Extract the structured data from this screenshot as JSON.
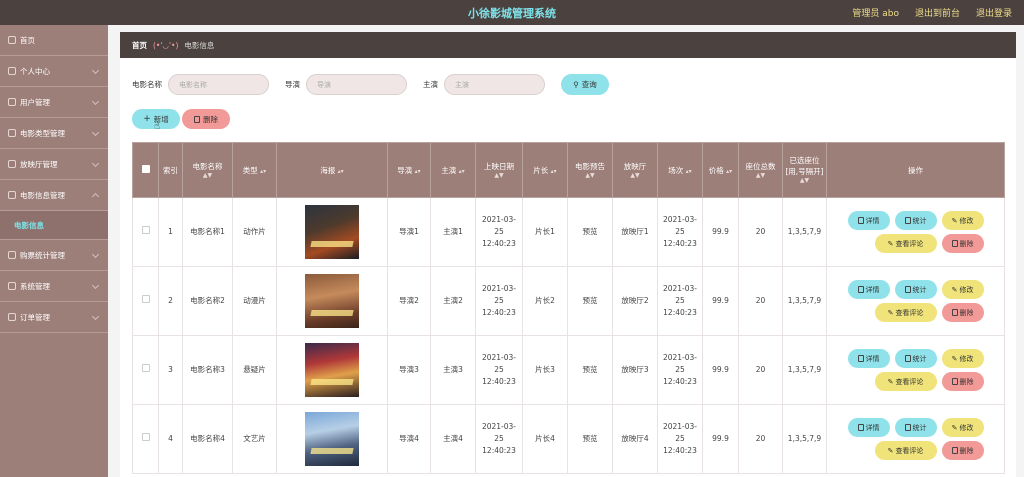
{
  "header": {
    "title": "小徐影城管理系统",
    "admin": "管理员 abo",
    "front": "退出到前台",
    "logout": "退出登录"
  },
  "sidebar": {
    "items": [
      {
        "label": "首页"
      },
      {
        "label": "个人中心"
      },
      {
        "label": "用户管理"
      },
      {
        "label": "电影类型管理"
      },
      {
        "label": "放映厅管理"
      },
      {
        "label": "电影信息管理"
      },
      {
        "label": "电影信息",
        "sub": true
      },
      {
        "label": "购票统计管理"
      },
      {
        "label": "系统管理"
      },
      {
        "label": "订单管理"
      }
    ]
  },
  "breadcrumb": {
    "home": "首页",
    "face": "(•'◡'•)",
    "current": "电影信息"
  },
  "search": {
    "name_label": "电影名称",
    "name_placeholder": "电影名称",
    "director_label": "导演",
    "director_placeholder": "导演",
    "actor_label": "主演",
    "actor_placeholder": "主演",
    "button": "查询"
  },
  "actions": {
    "add": "新增",
    "delete": "删除"
  },
  "table": {
    "headers": [
      "索引",
      "电影名称",
      "类型",
      "海报",
      "导演",
      "主演",
      "上映日期",
      "片长",
      "电影预告",
      "放映厅",
      "场次",
      "价格",
      "座位总数",
      "已选座位[用,号隔开]",
      "操作"
    ],
    "rows": [
      {
        "index": "1",
        "name": "电影名称1",
        "type": "动作片",
        "director": "导演1",
        "actor": "主演1",
        "date": "2021-03-25 12:40:23",
        "length": "片长1",
        "preview": "预览",
        "hall": "放映厅1",
        "session": "2021-03-25 12:40:23",
        "price": "99.9",
        "seats": "20",
        "selected": "1,3,5,7,9"
      },
      {
        "index": "2",
        "name": "电影名称2",
        "type": "动漫片",
        "director": "导演2",
        "actor": "主演2",
        "date": "2021-03-25 12:40:23",
        "length": "片长2",
        "preview": "预览",
        "hall": "放映厅2",
        "session": "2021-03-25 12:40:23",
        "price": "99.9",
        "seats": "20",
        "selected": "1,3,5,7,9"
      },
      {
        "index": "3",
        "name": "电影名称3",
        "type": "悬疑片",
        "director": "导演3",
        "actor": "主演3",
        "date": "2021-03-25 12:40:23",
        "length": "片长3",
        "preview": "预览",
        "hall": "放映厅3",
        "session": "2021-03-25 12:40:23",
        "price": "99.9",
        "seats": "20",
        "selected": "1,3,5,7,9"
      },
      {
        "index": "4",
        "name": "电影名称4",
        "type": "文艺片",
        "director": "导演4",
        "actor": "主演4",
        "date": "2021-03-25 12:40:23",
        "length": "片长4",
        "preview": "预览",
        "hall": "放映厅4",
        "session": "2021-03-25 12:40:23",
        "price": "99.9",
        "seats": "20",
        "selected": "1,3,5,7,9"
      }
    ],
    "ops": {
      "detail": "详情",
      "stat": "统计",
      "edit": "修改",
      "review": "查看评论",
      "remove": "删除"
    }
  }
}
